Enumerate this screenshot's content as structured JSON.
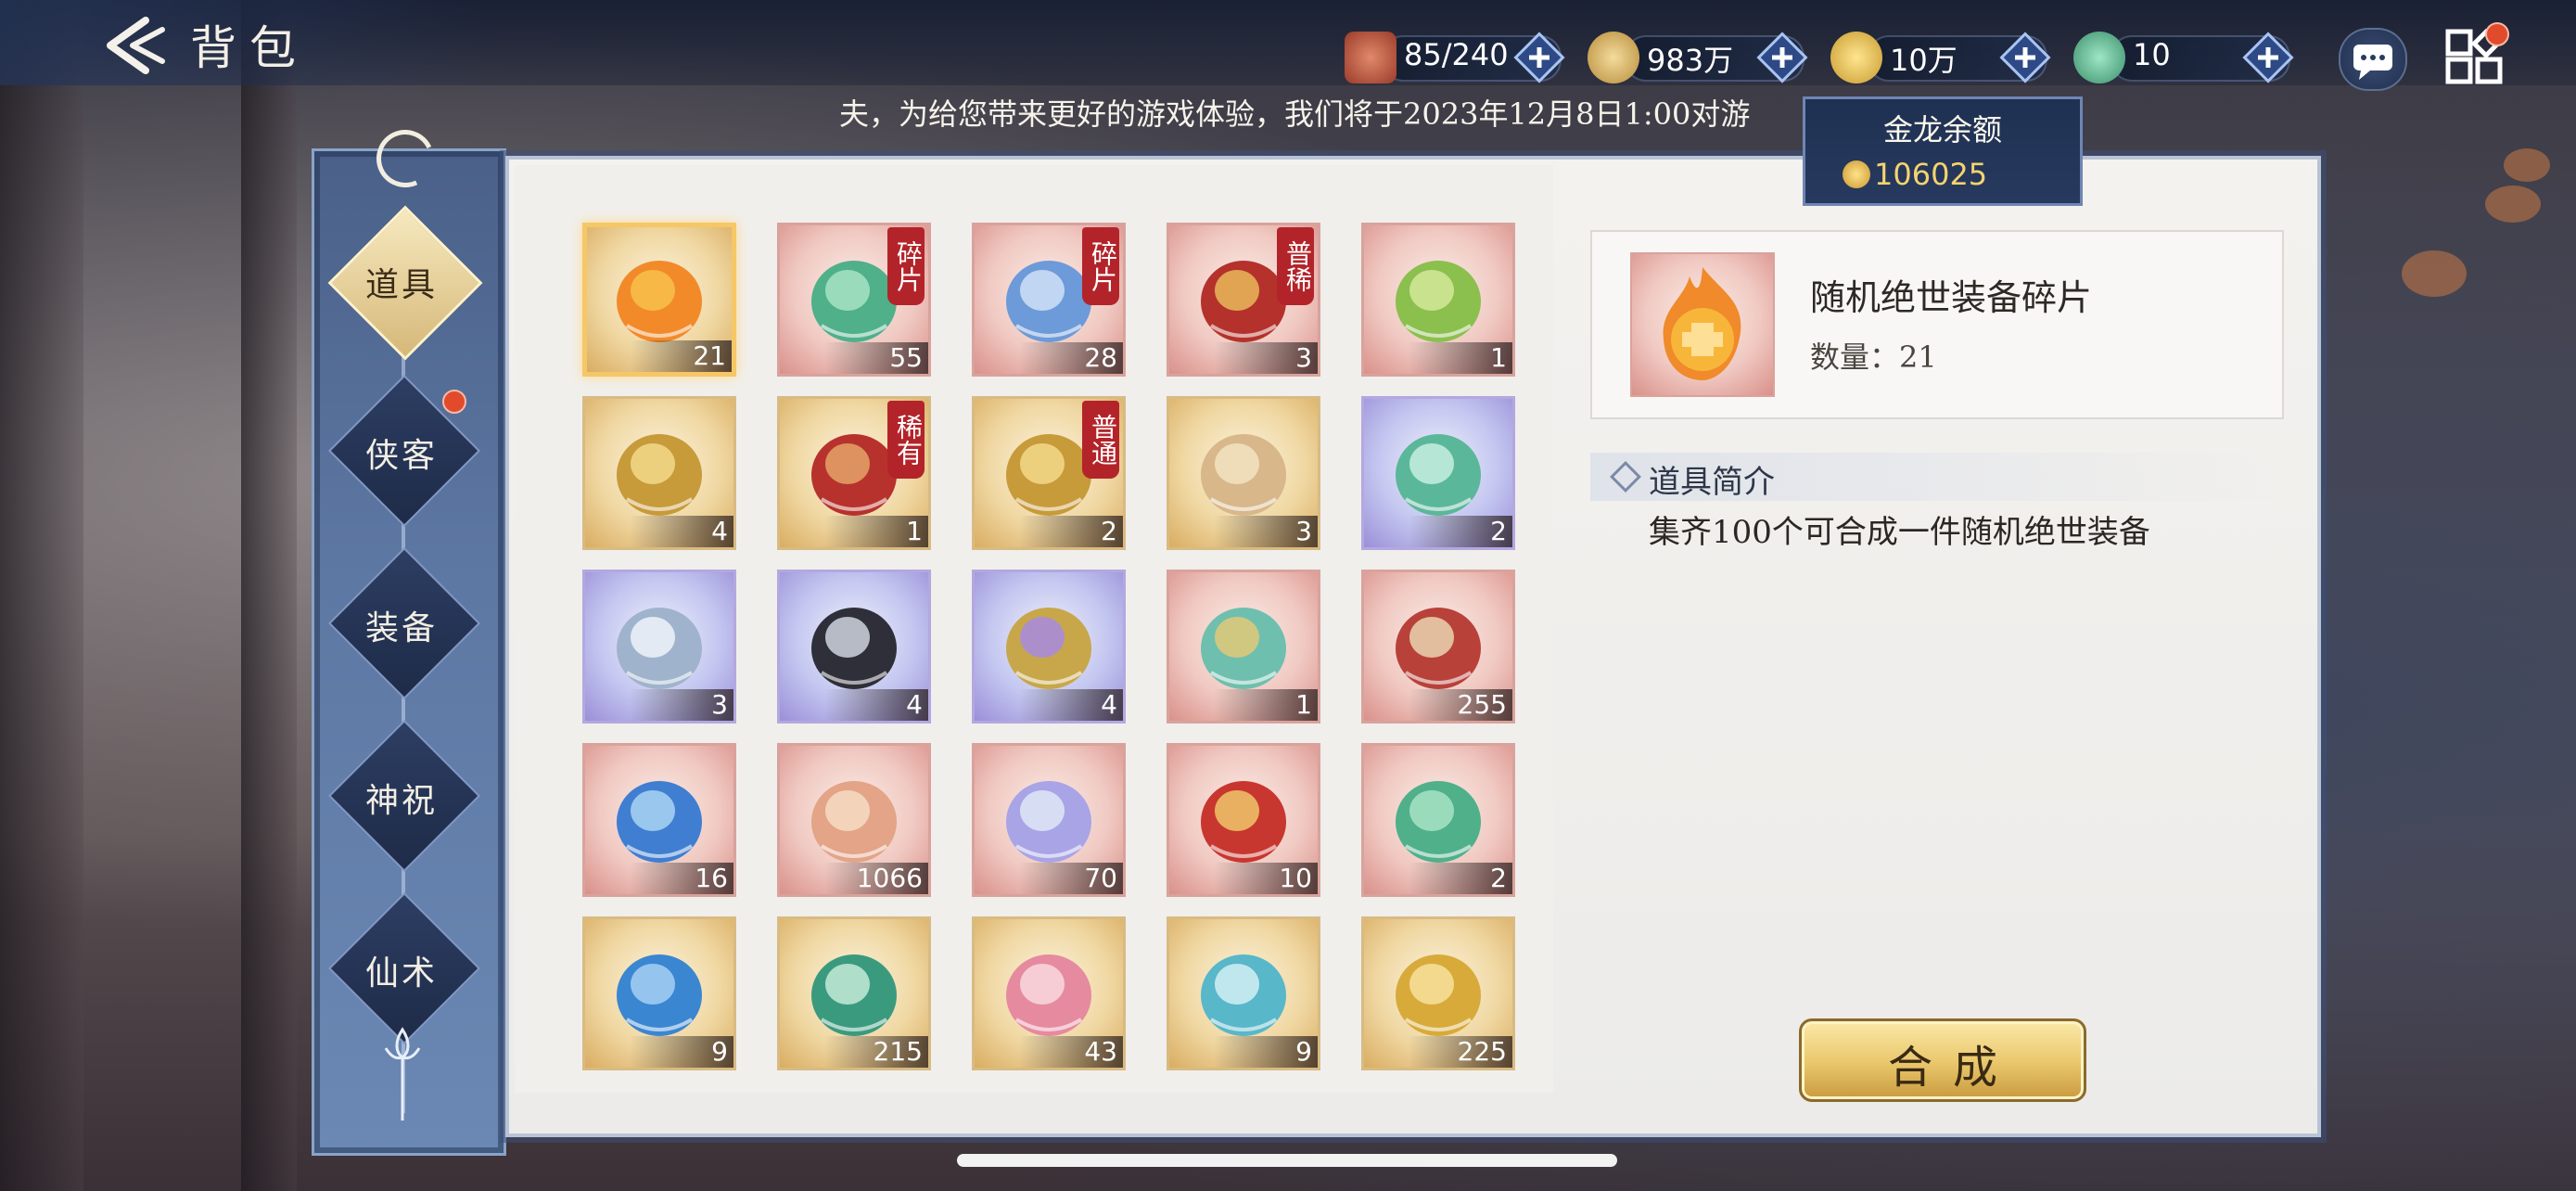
{
  "header": {
    "title": "背包",
    "resources": [
      {
        "name": "bag-capacity",
        "value": "85/240",
        "icon": "chest-icon",
        "color": "#b84a3a"
      },
      {
        "name": "copper",
        "value": "983万",
        "icon": "coin-icon",
        "color": "#c9a45a"
      },
      {
        "name": "gold-dragon",
        "value": "10万",
        "icon": "gold-dragon-icon",
        "color": "#e3b84a"
      },
      {
        "name": "jade-dragon",
        "value": "10",
        "icon": "jade-dragon-icon",
        "color": "#4fb08a"
      }
    ]
  },
  "notice": "夫，为给您带来更好的游戏体验，我们将于2023年12月8日1:00对游",
  "tooltip": {
    "title": "金龙余额",
    "value": "106025"
  },
  "sidebar": {
    "tabs": [
      {
        "label": "道具",
        "active": true,
        "badge": false
      },
      {
        "label": "侠客",
        "active": false,
        "badge": true
      },
      {
        "label": "装备",
        "active": false,
        "badge": false
      },
      {
        "label": "神祝",
        "active": false,
        "badge": false
      },
      {
        "label": "仙术",
        "active": false,
        "badge": false
      }
    ]
  },
  "items": [
    {
      "count": "21",
      "rarity": "gold",
      "tag": "",
      "icon": "flame-orb-icon",
      "selected": true
    },
    {
      "count": "55",
      "rarity": "red",
      "tag": "碎片",
      "icon": "jade-crystal-icon",
      "selected": false
    },
    {
      "count": "28",
      "rarity": "red",
      "tag": "碎片",
      "icon": "blue-crystal-icon",
      "selected": false
    },
    {
      "count": "3",
      "rarity": "red",
      "tag": "普稀",
      "icon": "gift-box-icon",
      "selected": false
    },
    {
      "count": "1",
      "rarity": "red",
      "tag": "",
      "icon": "spirit-pets-icon",
      "selected": false
    },
    {
      "count": "4",
      "rarity": "gold",
      "tag": "",
      "icon": "gold-chest-icon",
      "selected": false
    },
    {
      "count": "1",
      "rarity": "gold",
      "tag": "稀有",
      "icon": "red-chest-icon",
      "selected": false
    },
    {
      "count": "2",
      "rarity": "gold",
      "tag": "普通",
      "icon": "gold-chest-icon",
      "selected": false
    },
    {
      "count": "3",
      "rarity": "gold",
      "tag": "",
      "icon": "pouch-icon",
      "selected": false
    },
    {
      "count": "2",
      "rarity": "purple",
      "tag": "",
      "icon": "jade-token-icon",
      "selected": false
    },
    {
      "count": "3",
      "rarity": "purple",
      "tag": "",
      "icon": "silver-token-icon",
      "selected": false
    },
    {
      "count": "4",
      "rarity": "purple",
      "tag": "",
      "icon": "dark-token-icon",
      "selected": false
    },
    {
      "count": "4",
      "rarity": "purple",
      "tag": "",
      "icon": "scroll-icon",
      "selected": false
    },
    {
      "count": "1",
      "rarity": "red",
      "tag": "",
      "icon": "jade-cross-icon",
      "selected": false
    },
    {
      "count": "255",
      "rarity": "red",
      "tag": "",
      "icon": "talisman-icon",
      "selected": false
    },
    {
      "count": "16",
      "rarity": "red",
      "tag": "",
      "icon": "blue-orb-icon",
      "selected": false
    },
    {
      "count": "1066",
      "rarity": "red",
      "tag": "",
      "icon": "lucky-bag-icon",
      "selected": false
    },
    {
      "count": "70",
      "rarity": "red",
      "tag": "",
      "icon": "prism-crystal-icon",
      "selected": false
    },
    {
      "count": "10",
      "rarity": "red",
      "tag": "",
      "icon": "red-scroll-icon",
      "selected": false
    },
    {
      "count": "2",
      "rarity": "red",
      "tag": "",
      "icon": "jade-crystal-icon",
      "selected": false
    },
    {
      "count": "9",
      "rarity": "gold",
      "tag": "",
      "icon": "sapphire-icon",
      "selected": false
    },
    {
      "count": "215",
      "rarity": "gold",
      "tag": "",
      "icon": "banknote-icon",
      "selected": false
    },
    {
      "count": "43",
      "rarity": "gold",
      "tag": "",
      "icon": "lotus-icon",
      "selected": false
    },
    {
      "count": "9",
      "rarity": "gold",
      "tag": "",
      "icon": "ticket-icon",
      "selected": false
    },
    {
      "count": "225",
      "rarity": "gold",
      "tag": "",
      "icon": "gold-note-icon",
      "selected": false
    }
  ],
  "detail": {
    "name": "随机绝世装备碎片",
    "quantity_label": "数量：21",
    "intro_title": "道具简介",
    "intro_text": "集齐100个可合成一件随机绝世装备"
  },
  "actions": {
    "synthesize": "合成"
  }
}
